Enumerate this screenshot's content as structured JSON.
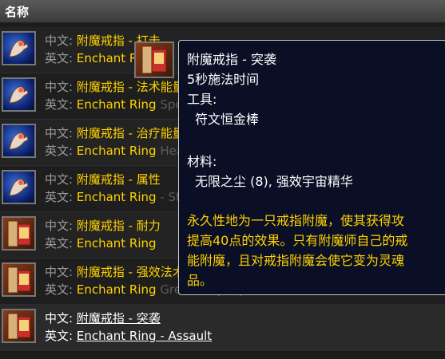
{
  "header": {
    "title": "名称"
  },
  "labels": {
    "cn": "中文:",
    "en": "英文:"
  },
  "rows": [
    {
      "icon": "enchant-hand-icon",
      "cn": "附魔戒指 - 打击",
      "en": "Enchant Ring",
      "ghost": ""
    },
    {
      "icon": "enchant-hand-icon",
      "cn": "附魔戒指 - 法术能量",
      "en": "Enchant Ring",
      "ghost": "Spellpower"
    },
    {
      "icon": "enchant-hand-icon",
      "cn": "附魔戒指 - 治疗能量",
      "en": "Enchant Ring",
      "ghost": "Healing Power"
    },
    {
      "icon": "enchant-hand-icon",
      "cn": "附魔戒指 - 属性",
      "en": "Enchant Ring",
      "ghost": "- Stats"
    },
    {
      "icon": "formula-scroll-icon",
      "cn": "附魔戒指 - 耐力",
      "en": "Enchant Ring",
      "ghost": ""
    },
    {
      "icon": "formula-scroll-icon",
      "cn": "附魔戒指 - 强效法术能量",
      "en": "Enchant Ring",
      "ghost": "Greater Spellpower"
    },
    {
      "icon": "formula-scroll-icon",
      "cn": "附魔戒指 - 突袭",
      "en": "Enchant Ring - Assault",
      "ghost": ""
    }
  ],
  "tooltip": {
    "title": "附魔戒指 - 突袭",
    "cast": "5秒施法时间",
    "tools_label": "工具:",
    "tool": "符文恒金棒",
    "materials_label": "材料:",
    "materials": "无限之尘 (8), 强效宇宙精华",
    "desc1": "永久性地为一只戒指附魔，使其获得攻",
    "desc2": "提高40点的效果。只有附魔师自己的戒",
    "desc3": "能附魔，且对戒指附魔会使它变为灵魂",
    "desc4": "品。"
  },
  "colors": {
    "accent": "#ffd200",
    "tooltip_bg": "#0a0f26",
    "label": "#9a9a9a"
  }
}
